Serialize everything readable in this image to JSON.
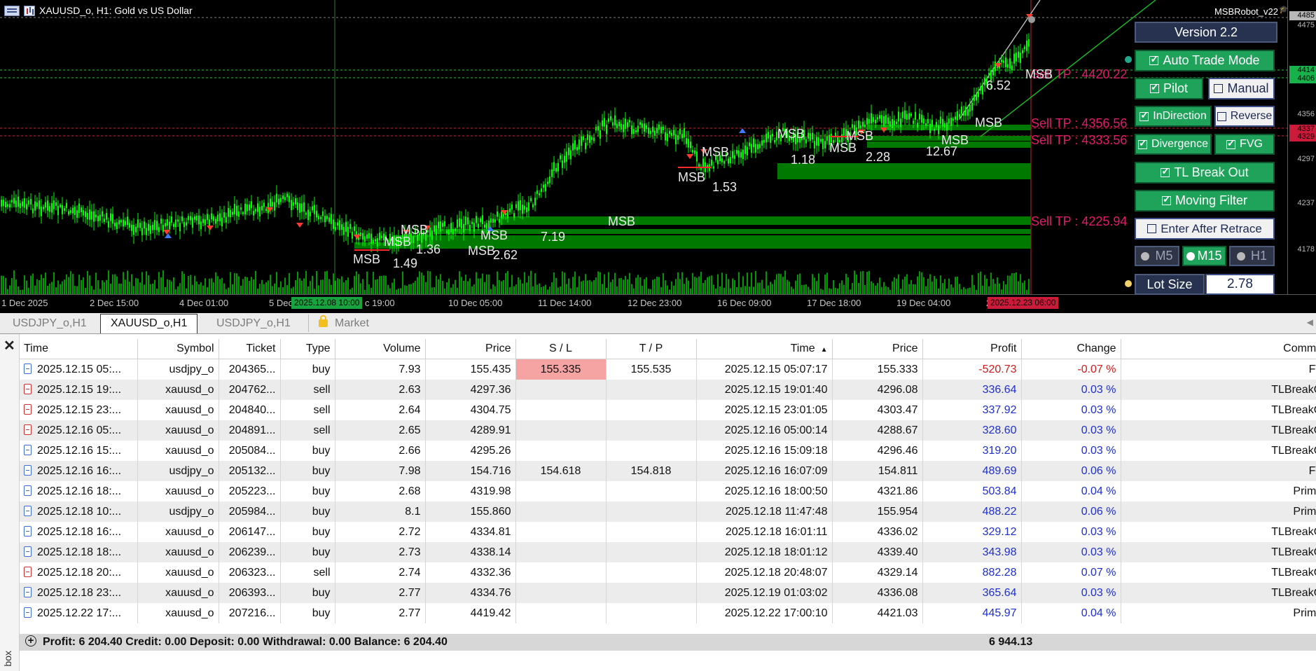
{
  "chart": {
    "title": "XAUUSD_o, H1:  Gold vs US Dollar",
    "robot_name": "MSBRobot_v22",
    "price_labels": [
      "4485",
      "4475",
      "4414",
      "4406",
      "4356",
      "4337",
      "4329",
      "4297",
      "4237",
      "4178"
    ],
    "time_labels": [
      "1 Dec 2025",
      "2 Dec 15:00",
      "4 Dec 01:00",
      "5 Dec",
      "c 19:00",
      "10 Dec 05:00",
      "11 Dec 14:00",
      "12 Dec 23:00",
      "16 Dec 09:00",
      "17 Dec 18:00",
      "19 Dec 04:00",
      "2"
    ],
    "crosshair_time_1": "2025.12.08 10:00",
    "crosshair_time_2": "2025.12.23 06:00",
    "tp_labels": [
      "Sell TP : 4420.22",
      "Sell TP : 4356.56",
      "Sell TP : 4333.56",
      "Sell TP : 4225.94"
    ],
    "msb_labels": [
      "MSB",
      "MSB",
      "MSB",
      "MSB",
      "MSB",
      "MSB",
      "MSB",
      "MSB",
      "MSB",
      "MSB",
      "MSB",
      "MSB",
      "MSB",
      "MSB"
    ],
    "value_labels": [
      "1.49",
      "1.36",
      "2.62",
      "7.19",
      "1.53",
      "1.18",
      "2.28",
      "12.67",
      "6.52"
    ],
    "colors": {
      "background": "#000000",
      "candle": "#00ff00",
      "zone": "#008000",
      "tp_text": "#e01b6a",
      "bearish_tag": "#cc1b3a"
    }
  },
  "panel": {
    "version": "Version 2.2",
    "auto_trade": "Auto Trade Mode",
    "pilot": "Pilot",
    "manual": "Manual",
    "in_direction": "InDirection",
    "reverse": "Reverse",
    "divergence": "Divergence",
    "fvg": "FVG",
    "tl_break_out": "TL Break Out",
    "moving_filter": "Moving Filter",
    "enter_after_retrace": "Enter After Retrace",
    "tf_m5": "M5",
    "tf_m15": "M15",
    "tf_h1": "H1",
    "lot_size_label": "Lot Size",
    "lot_size_value": "2.78",
    "checks": {
      "auto_trade": true,
      "pilot": true,
      "manual": false,
      "in_direction": true,
      "reverse": false,
      "divergence": true,
      "fvg": true,
      "tl_break_out": true,
      "moving_filter": true,
      "enter_after_retrace": false
    },
    "selected_timeframe": "M15"
  },
  "tabs": [
    {
      "label": "USDJPY_o,H1",
      "active": false
    },
    {
      "label": "XAUUSD_o,H1",
      "active": true
    },
    {
      "label": "USDJPY_o,H1",
      "active": false
    },
    {
      "label": "Market",
      "active": false,
      "icon": "lock-icon"
    }
  ],
  "terminal": {
    "side_label": "box",
    "columns": [
      "Time",
      "Symbol",
      "Ticket",
      "Type",
      "Volume",
      "Price",
      "S / L",
      "T / P",
      "Time",
      "Price",
      "Profit",
      "Change",
      "Comment"
    ],
    "rows": [
      {
        "time": "2025.12.15 05:...",
        "symbol": "usdjpy_o",
        "ticket": "204365...",
        "type": "buy",
        "volume": "7.93",
        "price": "155.435",
        "sl": "155.335",
        "tp": "155.535",
        "close_time": "2025.12.15 05:07:17",
        "close_price": "155.333",
        "profit": "-520.73",
        "change": "-0.07 %",
        "comment": "FVG"
      },
      {
        "time": "2025.12.15 19:...",
        "symbol": "xauusd_o",
        "ticket": "204762...",
        "type": "sell",
        "volume": "2.63",
        "price": "4297.36",
        "sl": "",
        "tp": "",
        "close_time": "2025.12.15 19:01:40",
        "close_price": "4296.08",
        "profit": "336.64",
        "change": "0.03 %",
        "comment": "TLBreakOut"
      },
      {
        "time": "2025.12.15 23:...",
        "symbol": "xauusd_o",
        "ticket": "204840...",
        "type": "sell",
        "volume": "2.64",
        "price": "4304.75",
        "sl": "",
        "tp": "",
        "close_time": "2025.12.15 23:01:05",
        "close_price": "4303.47",
        "profit": "337.92",
        "change": "0.03 %",
        "comment": "TLBreakOut"
      },
      {
        "time": "2025.12.16 05:...",
        "symbol": "xauusd_o",
        "ticket": "204891...",
        "type": "sell",
        "volume": "2.65",
        "price": "4289.91",
        "sl": "",
        "tp": "",
        "close_time": "2025.12.16 05:00:14",
        "close_price": "4288.67",
        "profit": "328.60",
        "change": "0.03 %",
        "comment": "TLBreakOut"
      },
      {
        "time": "2025.12.16 15:...",
        "symbol": "xauusd_o",
        "ticket": "205084...",
        "type": "buy",
        "volume": "2.66",
        "price": "4295.26",
        "sl": "",
        "tp": "",
        "close_time": "2025.12.16 15:09:18",
        "close_price": "4296.46",
        "profit": "319.20",
        "change": "0.03 %",
        "comment": "TLBreakOut"
      },
      {
        "time": "2025.12.16 16:...",
        "symbol": "usdjpy_o",
        "ticket": "205132...",
        "type": "buy",
        "volume": "7.98",
        "price": "154.716",
        "sl": "154.618",
        "tp": "154.818",
        "close_time": "2025.12.16 16:07:09",
        "close_price": "154.811",
        "profit": "489.69",
        "change": "0.06 %",
        "comment": "FVG"
      },
      {
        "time": "2025.12.16 18:...",
        "symbol": "xauusd_o",
        "ticket": "205223...",
        "type": "buy",
        "volume": "2.68",
        "price": "4319.98",
        "sl": "",
        "tp": "",
        "close_time": "2025.12.16 18:00:50",
        "close_price": "4321.86",
        "profit": "503.84",
        "change": "0.04 %",
        "comment": "Primary"
      },
      {
        "time": "2025.12.18 10:...",
        "symbol": "usdjpy_o",
        "ticket": "205984...",
        "type": "buy",
        "volume": "8.1",
        "price": "155.860",
        "sl": "",
        "tp": "",
        "close_time": "2025.12.18 11:47:48",
        "close_price": "155.954",
        "profit": "488.22",
        "change": "0.06 %",
        "comment": "Primary"
      },
      {
        "time": "2025.12.18 16:...",
        "symbol": "xauusd_o",
        "ticket": "206147...",
        "type": "buy",
        "volume": "2.72",
        "price": "4334.81",
        "sl": "",
        "tp": "",
        "close_time": "2025.12.18 16:01:11",
        "close_price": "4336.02",
        "profit": "329.12",
        "change": "0.03 %",
        "comment": "TLBreakOut"
      },
      {
        "time": "2025.12.18 18:...",
        "symbol": "xauusd_o",
        "ticket": "206239...",
        "type": "buy",
        "volume": "2.73",
        "price": "4338.14",
        "sl": "",
        "tp": "",
        "close_time": "2025.12.18 18:01:12",
        "close_price": "4339.40",
        "profit": "343.98",
        "change": "0.03 %",
        "comment": "TLBreakOut"
      },
      {
        "time": "2025.12.18 20:...",
        "symbol": "xauusd_o",
        "ticket": "206323...",
        "type": "sell",
        "volume": "2.74",
        "price": "4332.36",
        "sl": "",
        "tp": "",
        "close_time": "2025.12.18 20:48:07",
        "close_price": "4329.14",
        "profit": "882.28",
        "change": "0.07 %",
        "comment": "TLBreakOut"
      },
      {
        "time": "2025.12.18 23:...",
        "symbol": "xauusd_o",
        "ticket": "206393...",
        "type": "buy",
        "volume": "2.77",
        "price": "4334.76",
        "sl": "",
        "tp": "",
        "close_time": "2025.12.19 01:03:02",
        "close_price": "4336.08",
        "profit": "365.64",
        "change": "0.03 %",
        "comment": "TLBreakOut"
      },
      {
        "time": "2025.12.22 17:...",
        "symbol": "xauusd_o",
        "ticket": "207216...",
        "type": "buy",
        "volume": "2.77",
        "price": "4419.42",
        "sl": "",
        "tp": "",
        "close_time": "2025.12.22 17:00:10",
        "close_price": "4421.03",
        "profit": "445.97",
        "change": "0.04 %",
        "comment": "Primary"
      }
    ],
    "summary_text": "Profit: 6 204.40   Credit: 0.00   Deposit: 0.00   Withdrawal: 0.00   Balance: 6 204.40",
    "summary_profit": "6 944.13"
  }
}
